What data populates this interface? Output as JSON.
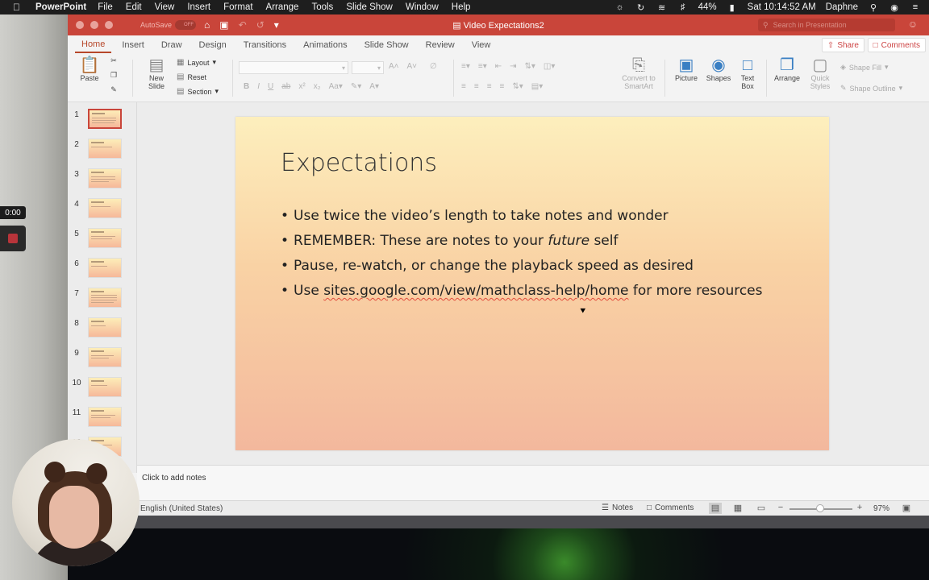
{
  "menubar": {
    "app_name": "PowerPoint",
    "items": [
      "File",
      "Edit",
      "View",
      "Insert",
      "Format",
      "Arrange",
      "Tools",
      "Slide Show",
      "Window",
      "Help"
    ],
    "battery": "44%",
    "clock": "Sat 10:14:52 AM",
    "user": "Daphne"
  },
  "window": {
    "title": "Video Expectations2",
    "autosave_label": "AutoSave",
    "autosave_state": "OFF",
    "search_placeholder": "Search in Presentation"
  },
  "ribbon": {
    "tabs": [
      "Home",
      "Insert",
      "Draw",
      "Design",
      "Transitions",
      "Animations",
      "Slide Show",
      "Review",
      "View"
    ],
    "active_tab": "Home",
    "share_label": "Share",
    "comments_label": "Comments",
    "paste_label": "Paste",
    "new_slide_label_1": "New",
    "new_slide_label_2": "Slide",
    "layout_label": "Layout",
    "reset_label": "Reset",
    "section_label": "Section",
    "smartart_label_1": "Convert to",
    "smartart_label_2": "SmartArt",
    "picture_label": "Picture",
    "shapes_label": "Shapes",
    "textbox_label_1": "Text",
    "textbox_label_2": "Box",
    "arrange_label": "Arrange",
    "quick_styles_label_1": "Quick",
    "quick_styles_label_2": "Styles",
    "shape_fill_label": "Shape Fill",
    "shape_outline_label": "Shape Outline"
  },
  "thumbnails": [
    {
      "number": "1",
      "selected": true
    },
    {
      "number": "2"
    },
    {
      "number": "3"
    },
    {
      "number": "4"
    },
    {
      "number": "5"
    },
    {
      "number": "6"
    },
    {
      "number": "7"
    },
    {
      "number": "8"
    },
    {
      "number": "9"
    },
    {
      "number": "10"
    },
    {
      "number": "11"
    },
    {
      "number": "12"
    }
  ],
  "slide": {
    "title": "Expectations",
    "bullet_1": "Use twice the video’s length to take notes and wonder",
    "bullet_2_pre": "REMEMBER: These are notes to your ",
    "bullet_2_em": "future",
    "bullet_2_post": " self",
    "bullet_3": "Pause, re-watch, or change the playback speed as desired",
    "bullet_4_pre": "Use ",
    "bullet_4_link": "sites.google.com/view/mathclass-help/home",
    "bullet_4_post": " for more resources"
  },
  "notes": {
    "placeholder": "Click to add notes"
  },
  "statusbar": {
    "language": "English (United States)",
    "notes_label": "Notes",
    "comments_label": "Comments",
    "zoom": "97%"
  },
  "recorder": {
    "time": "0:00"
  },
  "colors": {
    "accent": "#c9453a",
    "slide_top": "#fdefbd",
    "slide_bottom": "#f3b89d"
  }
}
